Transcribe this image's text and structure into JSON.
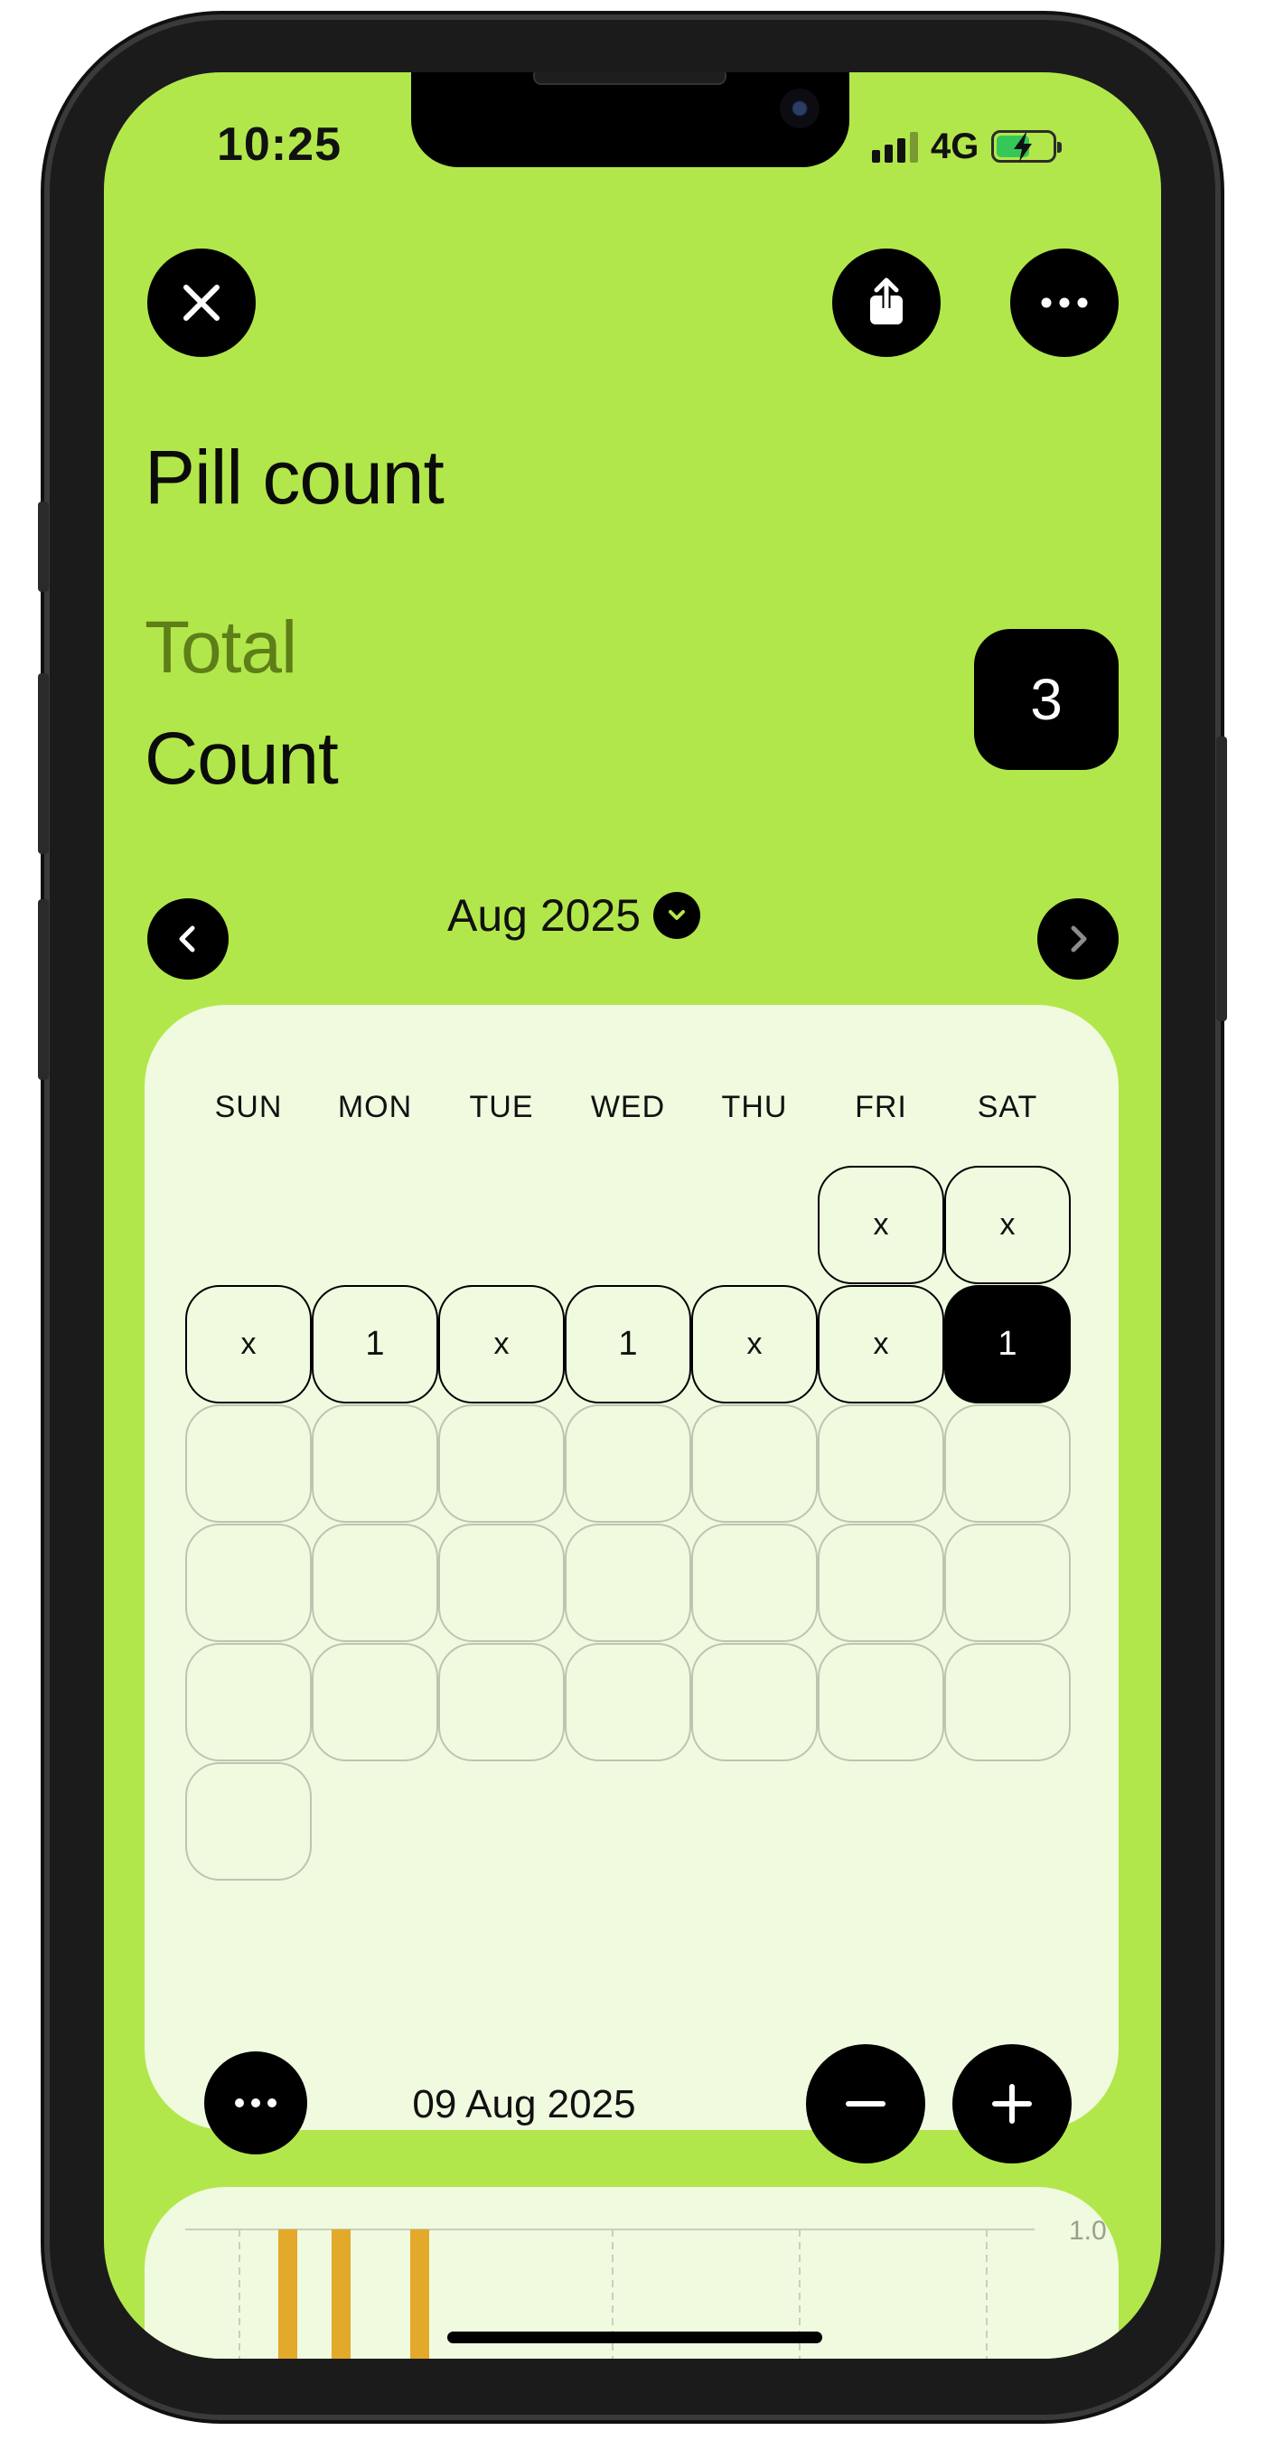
{
  "status": {
    "time": "10:25",
    "network": "4G"
  },
  "header": {
    "title": "Pill count"
  },
  "summary": {
    "total_label": "Total",
    "count_label": "Count",
    "count_value": "3"
  },
  "month_nav": {
    "label": "Aug 2025"
  },
  "calendar": {
    "weekdays": [
      "SUN",
      "MON",
      "TUE",
      "WED",
      "THU",
      "FRI",
      "SAT"
    ],
    "rows": [
      [
        "",
        "",
        "",
        "",
        "",
        "x",
        "x"
      ],
      [
        "x",
        "1",
        "x",
        "1",
        "x",
        "x",
        "1"
      ],
      [
        "",
        "",
        "",
        "",
        "",
        "",
        ""
      ],
      [
        "",
        "",
        "",
        "",
        "",
        "",
        ""
      ],
      [
        "",
        "",
        "",
        "",
        "",
        "",
        ""
      ],
      [
        ""
      ]
    ],
    "selected_date": "09 Aug 2025"
  },
  "chart": {
    "y_tick_label": "1.0",
    "bar_color": "#e3a92b",
    "bar_count": 3
  },
  "colors": {
    "background": "#b2e74b",
    "card": "#f0fadf",
    "accent_dark": "#000000",
    "muted_label": "#5e7e18"
  }
}
